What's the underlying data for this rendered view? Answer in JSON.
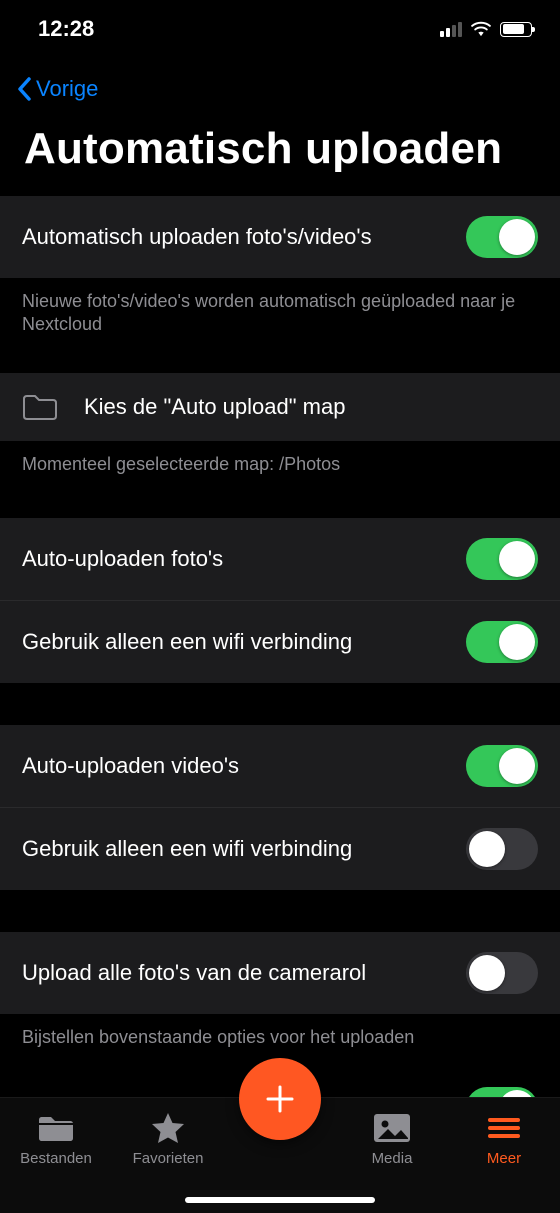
{
  "status": {
    "time": "12:28"
  },
  "nav": {
    "back_label": "Vorige"
  },
  "page": {
    "title": "Automatisch uploaden"
  },
  "sections": {
    "main_toggle": {
      "label": "Automatisch uploaden foto's/video's",
      "on": true,
      "footer": "Nieuwe foto's/video's worden automatisch geüploaded naar je Nextcloud"
    },
    "folder": {
      "label": "Kies de \"Auto upload\" map",
      "footer": "Momenteel geselecteerde map: /Photos"
    },
    "photos": {
      "auto_label": "Auto-uploaden foto's",
      "auto_on": true,
      "wifi_label": "Gebruik alleen een wifi verbinding",
      "wifi_on": true
    },
    "videos": {
      "auto_label": "Auto-uploaden video's",
      "auto_on": true,
      "wifi_label": "Gebruik alleen een wifi verbinding",
      "wifi_on": false
    },
    "cameraroll": {
      "label": "Upload alle foto's van de camerarol",
      "on": false,
      "footer": "Bijstellen bovenstaande opties voor het uploaden"
    }
  },
  "tabs": {
    "files": "Bestanden",
    "favorites": "Favorieten",
    "media": "Media",
    "more": "Meer"
  }
}
